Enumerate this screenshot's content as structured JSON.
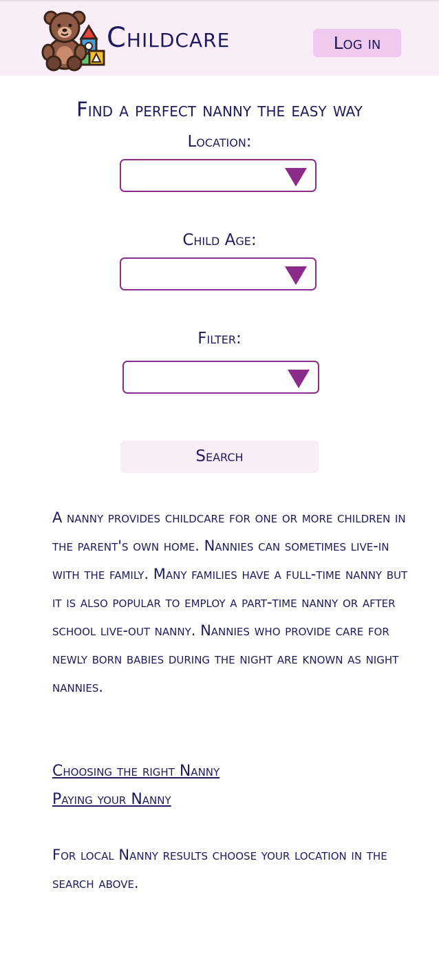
{
  "header": {
    "brand": "Childcare",
    "login_label": "Log in",
    "logo_icon": "teddy-bear-with-blocks-icon"
  },
  "search_form": {
    "title": "Find a perfect nanny the easy way",
    "location_label": "Location:",
    "child_age_label": "Child Age:",
    "filter_label": "Filter:",
    "location_value": "",
    "child_age_value": "",
    "filter_value": "",
    "search_label": "Search"
  },
  "content": {
    "description": "A nanny provides childcare for one or more children in the parent's own home. Nannies can sometimes live-in with the family. Many families have a full-time nanny but it is also popular to employ a part-time nanny or after school live-out nanny. Nannies who provide care for newly born babies during the night are known as night nannies.",
    "links": [
      "Choosing the right Nanny",
      "Paying your Nanny"
    ],
    "note": "For local Nanny results choose your location in the search above."
  },
  "colors": {
    "text": "#1f1a5c",
    "accent": "#8b2c8b",
    "header_bg": "#f9eef8",
    "button_bg": "#efc8ee"
  }
}
